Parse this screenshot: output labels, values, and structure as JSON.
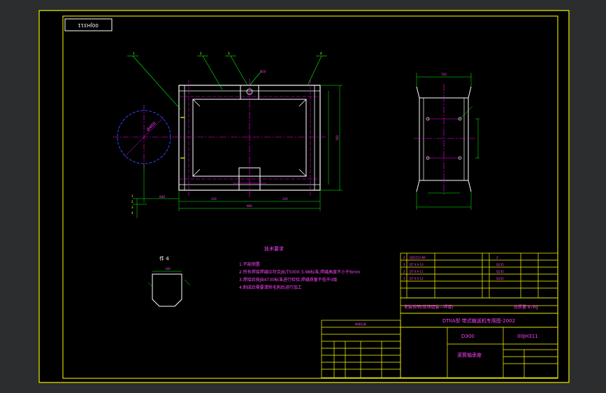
{
  "colors": {
    "background": "#2c2d2f",
    "paper": "#000000",
    "border": "#ffff00",
    "part": "#ffffff",
    "centerline": "#ff00ff",
    "dimension": "#00ff00",
    "pulley": "#3333ff",
    "text": "#ff44ff"
  },
  "drawing": {
    "stamp": "00JH311",
    "leaders": [
      "1",
      "2",
      "3",
      "4"
    ],
    "side_leaders": [
      "1",
      "2",
      "3",
      "4"
    ],
    "dims": {
      "width_total": "860",
      "left_seg": "224",
      "right_seg": "224",
      "height_total": "560",
      "side_width": "720",
      "left_margin": "B46",
      "diameter": "Ø400"
    },
    "section_label": "件 4",
    "section_dim": "100",
    "notes": {
      "title": "技术要求",
      "lines": [
        "1.不能倒置",
        "2.所有焊接焊缝应符合JB/T5000.3-98标准,焊缝高度不小于6mm",
        "3.焊接后按JB4730标准进行检验,焊缝质量不低于II级",
        "4.制成后需要清除毛刺后进行加工"
      ]
    }
  },
  "title_block": {
    "rows": [
      [
        "4",
        "GB1152-89",
        "Z"
      ],
      [
        "3",
        "DT II A-10",
        "Q235"
      ],
      [
        "2",
        "DT II A-11",
        "Q235"
      ],
      [
        "1",
        "DT II A-12",
        "Q235"
      ]
    ],
    "mass_note": "安装说明(现场组装—焊接)",
    "mass": "总质量 87kg",
    "series": "DTIIA型 带式输送机专用图-2002",
    "code": "D300",
    "drawing_no": "00JH311",
    "name": "滚筒轴承座",
    "small_table_title": "修改记录"
  }
}
